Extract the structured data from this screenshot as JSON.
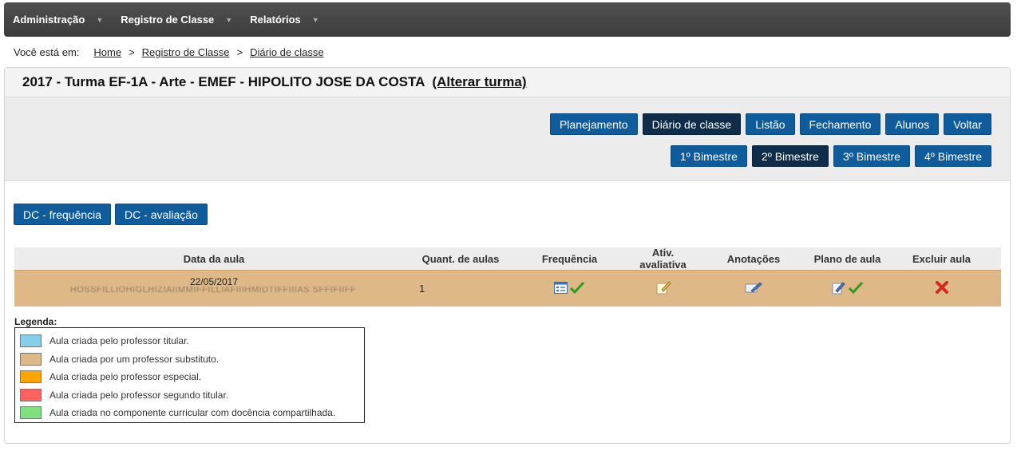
{
  "nav": {
    "items": [
      {
        "label": "Administração"
      },
      {
        "label": "Registro de Classe"
      },
      {
        "label": "Relatórios"
      }
    ],
    "caret": "▼"
  },
  "breadcrumb": {
    "prefix": "Você está em:",
    "items": [
      "Home",
      "Registro de Classe",
      "Diário de classe"
    ],
    "separator": ">"
  },
  "panel": {
    "title": "2017 - Turma EF-1A - Arte - EMEF - HIPOLITO JOSE DA COSTA",
    "alter_link": "(Alterar turma)"
  },
  "toolbar": {
    "row1": [
      "Planejamento",
      "Diário de classe",
      "Listão",
      "Fechamento",
      "Alunos",
      "Voltar"
    ],
    "row1_active": "Diário de classe",
    "row2": [
      "1º Bimestre",
      "2º Bimestre",
      "3º Bimestre",
      "4º Bimestre"
    ],
    "row2_active": "2º Bimestre"
  },
  "dc_buttons": [
    "DC - frequência",
    "DC - avaliação"
  ],
  "table": {
    "headers": [
      "Data da aula",
      "Quant. de aulas",
      "Frequência",
      "Ativ. avaliativa",
      "Anotações",
      "Plano de aula",
      "Excluir aula"
    ],
    "rows": [
      {
        "date": "22/05/2017",
        "teacher": "HOSSFILLIOHIGLHIZIAIIMMIFFILLIAFIIIHMIDTIFFIIIAS SFFIFIIFF",
        "quantity": "1",
        "row_color": "#deb887"
      }
    ]
  },
  "legend": {
    "title": "Legenda:",
    "items": [
      {
        "label": "Aula criada pelo professor titular.",
        "color": "#87ceeb"
      },
      {
        "label": "Aula criada por um professor substituto.",
        "color": "#deb887"
      },
      {
        "label": "Aula criada pelo professor especial.",
        "color": "#ffa500"
      },
      {
        "label": "Aula criada pelo professor segundo titular.",
        "color": "#ff6060"
      },
      {
        "label": "Aula criada no componente curricular com docência compartilhada.",
        "color": "#80e080"
      }
    ]
  },
  "colors": {
    "primary_button": "#0f5c9c",
    "active_button": "#0d2d4a",
    "navbar": "#444444"
  }
}
